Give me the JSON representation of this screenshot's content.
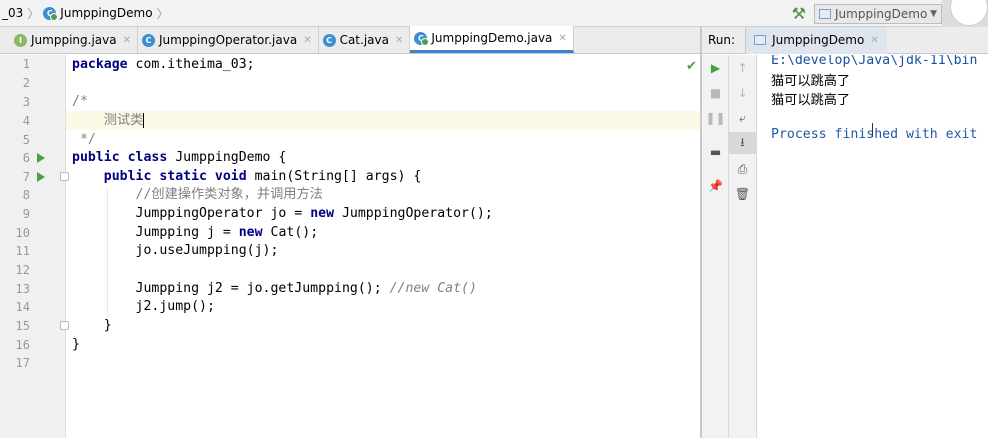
{
  "navbar": {
    "breadcrumb_pkg": "_03",
    "breadcrumb_class": "JumppingDemo",
    "run_config": "JumppingDemo"
  },
  "editor_tabs": [
    {
      "label": "Jumpping.java",
      "kind": "interface",
      "active": false
    },
    {
      "label": "JumppingOperator.java",
      "kind": "class",
      "active": false
    },
    {
      "label": "Cat.java",
      "kind": "class",
      "active": false
    },
    {
      "label": "JumppingDemo.java",
      "kind": "class-main",
      "active": true
    }
  ],
  "editor": {
    "line_numbers": [
      "1",
      "2",
      "3",
      "4",
      "5",
      "6",
      "7",
      "8",
      "9",
      "10",
      "11",
      "12",
      "13",
      "14",
      "15",
      "16",
      "17"
    ],
    "lines": {
      "l1_kw": "package",
      "l1_rest": " com.itheima_03;",
      "l3": "/*",
      "l4": "    测试类",
      "l5": " */",
      "l6_kw": "public class",
      "l6_rest": " JumppingDemo {",
      "l7_kw1": "    public static void",
      "l7_rest": " main(String[] args) {",
      "l8": "        //创建操作类对象，并调用方法",
      "l9_a": "        JumppingOperator jo = ",
      "l9_kw": "new",
      "l9_b": " JumppingOperator();",
      "l10_a": "        Jumpping j = ",
      "l10_kw": "new",
      "l10_b": " Cat();",
      "l11": "        jo.useJumpping(j);",
      "l13_a": "        Jumpping j2 = jo.getJumpping(); ",
      "l13_cm": "//new Cat()",
      "l14": "        j2.jump();",
      "l15": "    }",
      "l16": "}"
    }
  },
  "run_panel": {
    "label": "Run:",
    "tab": "JumppingDemo",
    "console_lines": {
      "path": "E:\\develop\\Java\\jdk-11\\bin",
      "out1": "猫可以跳高了",
      "out2": "猫可以跳高了",
      "process": "Process finished with exit"
    }
  },
  "colors": {
    "keyword": "#000080",
    "comment": "#808080",
    "run_green": "#49a146",
    "highlight_line": "#fcfae6",
    "active_tab_underline": "#4083c9"
  }
}
